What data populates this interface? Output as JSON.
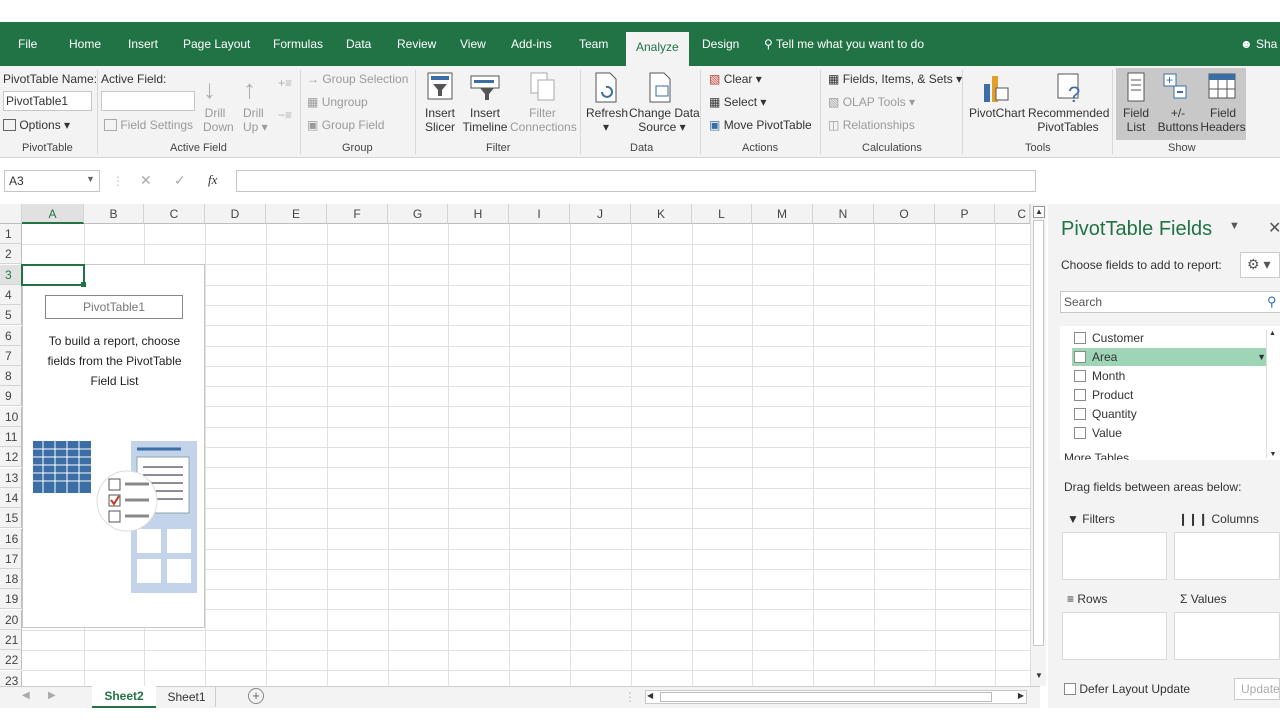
{
  "tabs": [
    "File",
    "Home",
    "Insert",
    "Page Layout",
    "Formulas",
    "Data",
    "Review",
    "View",
    "Add-ins",
    "Team",
    "Analyze",
    "Design"
  ],
  "tell_me": "Tell me what you want to do",
  "user_short": "Sha",
  "ribbon": {
    "pivottable_name_label": "PivotTable Name:",
    "pivottable_name_value": "PivotTable1",
    "options": "Options",
    "group_pivottable": "PivotTable",
    "active_field_label": "Active Field:",
    "field_settings": "Field Settings",
    "drill_down": [
      "Drill",
      "Down"
    ],
    "drill_up": [
      "Drill",
      "Up"
    ],
    "group_active_field": "Active Field",
    "group_selection": "Group Selection",
    "ungroup": "Ungroup",
    "group_field": "Group Field",
    "group_group": "Group",
    "insert_slicer": [
      "Insert",
      "Slicer"
    ],
    "insert_timeline": [
      "Insert",
      "Timeline"
    ],
    "filter_connections": [
      "Filter",
      "Connections"
    ],
    "group_filter": "Filter",
    "refresh": "Refresh",
    "change_data_source": [
      "Change Data",
      "Source"
    ],
    "group_data": "Data",
    "clear": "Clear",
    "select": "Select",
    "move_pivottable": "Move PivotTable",
    "group_actions": "Actions",
    "fields_items_sets": "Fields, Items, & Sets",
    "olap_tools": "OLAP Tools",
    "relationships": "Relationships",
    "group_calculations": "Calculations",
    "pivotchart": "PivotChart",
    "recommended_pivottables": [
      "Recommended",
      "PivotTables"
    ],
    "group_tools": "Tools",
    "field_list": [
      "Field",
      "List"
    ],
    "buttons": [
      "+/-",
      "Buttons"
    ],
    "field_headers": [
      "Field",
      "Headers"
    ],
    "group_show": "Show"
  },
  "formula": {
    "cell_ref": "A3",
    "fx": "fx",
    "value": ""
  },
  "columns": [
    "A",
    "B",
    "C",
    "D",
    "E",
    "F",
    "G",
    "H",
    "I",
    "J",
    "K",
    "L",
    "M",
    "N",
    "O",
    "P",
    "C"
  ],
  "rows": [
    "1",
    "2",
    "3",
    "4",
    "5",
    "6",
    "7",
    "8",
    "9",
    "10",
    "11",
    "12",
    "13",
    "14",
    "15",
    "16",
    "17",
    "18",
    "19",
    "20",
    "21",
    "22",
    "23"
  ],
  "placeholder": {
    "title": "PivotTable1",
    "line1": "To build a report, choose",
    "line2": "fields from the PivotTable",
    "line3": "Field List"
  },
  "sheets": {
    "active": "Sheet2",
    "other": "Sheet1"
  },
  "panel": {
    "title": "PivotTable Fields",
    "choose_label": "Choose fields to add to report:",
    "search_placeholder": "Search",
    "fields": [
      "Customer",
      "Area",
      "Month",
      "Product",
      "Quantity",
      "Value"
    ],
    "more_tables_partial": "More Tables...",
    "drag_label": "Drag fields between areas below:",
    "filters": "Filters",
    "columns": "Columns",
    "rows": "Rows",
    "values": "Values",
    "defer": "Defer Layout Update",
    "update": "Update"
  },
  "colors": {
    "accent": "#217346",
    "highlight_row": "#9fd5b7"
  }
}
